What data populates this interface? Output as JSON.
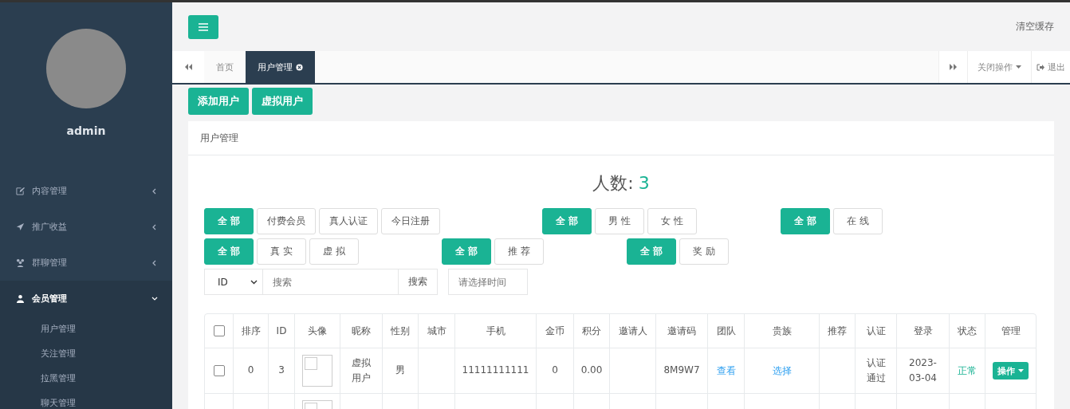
{
  "sidebar": {
    "user": {
      "name": "admin"
    },
    "menu": [
      {
        "label": "内容管理",
        "kind": "edit",
        "expanded": false
      },
      {
        "label": "推广收益",
        "kind": "send",
        "expanded": false
      },
      {
        "label": "群聊管理",
        "kind": "group",
        "expanded": false
      },
      {
        "label": "会员管理",
        "kind": "user",
        "expanded": true,
        "children": [
          {
            "label": "用户管理"
          },
          {
            "label": "关注管理"
          },
          {
            "label": "拉黑管理"
          },
          {
            "label": "聊天管理"
          }
        ]
      }
    ]
  },
  "header": {
    "clear_cache": "清空缓存"
  },
  "tabs": [
    {
      "label": "首页",
      "selected": false,
      "closable": false
    },
    {
      "label": "用户管理",
      "selected": true,
      "closable": true
    }
  ],
  "tab_actions": {
    "close_menu": "关闭操作",
    "logout": "退出"
  },
  "toolbar_buttons": [
    "添加用户",
    "虚拟用户"
  ],
  "panel": {
    "title": "用户管理",
    "count_label": "人数:",
    "count": "3",
    "filter_rows": [
      [
        [
          {
            "label": "全 部",
            "selected": true
          },
          {
            "label": "付费会员",
            "selected": false
          },
          {
            "label": "真人认证",
            "selected": false
          },
          {
            "label": "今日注册",
            "selected": false
          }
        ],
        [
          {
            "label": "全 部",
            "selected": true
          },
          {
            "label": "男 性",
            "selected": false
          },
          {
            "label": "女 性",
            "selected": false
          }
        ],
        [
          {
            "label": "全 部",
            "selected": true
          },
          {
            "label": "在 线",
            "selected": false
          }
        ]
      ],
      [
        [
          {
            "label": "全 部",
            "selected": true
          },
          {
            "label": "真 实",
            "selected": false
          },
          {
            "label": "虚 拟",
            "selected": false
          }
        ],
        [
          {
            "label": "全 部",
            "selected": true
          },
          {
            "label": "推 荐",
            "selected": false
          }
        ],
        [
          {
            "label": "全 部",
            "selected": true
          },
          {
            "label": "奖 励",
            "selected": false
          }
        ]
      ]
    ],
    "search": {
      "field": "ID",
      "placeholder": "搜索",
      "button": "搜索",
      "date_placeholder": "请选择时间"
    },
    "table": {
      "columns": [
        {
          "kind": "check",
          "checked": false
        },
        {
          "label": "排序"
        },
        {
          "label": "ID"
        },
        {
          "label": "头像"
        },
        {
          "label": "昵称"
        },
        {
          "label": "性别"
        },
        {
          "label": "城市"
        },
        {
          "label": "手机"
        },
        {
          "label": "金币"
        },
        {
          "label": "积分"
        },
        {
          "label": "邀请人"
        },
        {
          "label": "邀请码"
        },
        {
          "label": "团队"
        },
        {
          "label": "贵族"
        },
        {
          "label": "推荐"
        },
        {
          "label": "认证"
        },
        {
          "label": "登录"
        },
        {
          "label": "状态"
        },
        {
          "label": "管理"
        }
      ],
      "rows": [
        [
          {
            "kind": "check",
            "checked": false
          },
          {
            "kind": "text",
            "text": "0"
          },
          {
            "kind": "text",
            "text": "3"
          },
          {
            "kind": "avatar"
          },
          {
            "kind": "text",
            "text": "虚拟用户"
          },
          {
            "kind": "text",
            "text": "男"
          },
          {
            "kind": "empty"
          },
          {
            "kind": "text",
            "text": "11111111111"
          },
          {
            "kind": "text",
            "text": "0"
          },
          {
            "kind": "text",
            "text": "0.00"
          },
          {
            "kind": "empty"
          },
          {
            "kind": "text",
            "text": "8M9W7"
          },
          {
            "kind": "link",
            "text": "查看"
          },
          {
            "kind": "link",
            "text": "选择"
          },
          {
            "kind": "empty"
          },
          {
            "kind": "text",
            "text": "认证通过"
          },
          {
            "kind": "text",
            "text": "2023-03-04"
          },
          {
            "kind": "status",
            "text": "正常"
          },
          {
            "kind": "action",
            "text": "操作"
          }
        ],
        [
          {
            "kind": "empty"
          },
          {
            "kind": "empty"
          },
          {
            "kind": "empty"
          },
          {
            "kind": "avatar"
          },
          {
            "kind": "empty"
          },
          {
            "kind": "empty"
          },
          {
            "kind": "empty"
          },
          {
            "kind": "empty"
          },
          {
            "kind": "empty"
          },
          {
            "kind": "empty"
          },
          {
            "kind": "empty"
          },
          {
            "kind": "empty"
          },
          {
            "kind": "empty"
          },
          {
            "kind": "empty"
          },
          {
            "kind": "empty"
          },
          {
            "kind": "empty"
          },
          {
            "kind": "empty"
          },
          {
            "kind": "empty"
          },
          {
            "kind": "empty"
          }
        ]
      ]
    }
  }
}
